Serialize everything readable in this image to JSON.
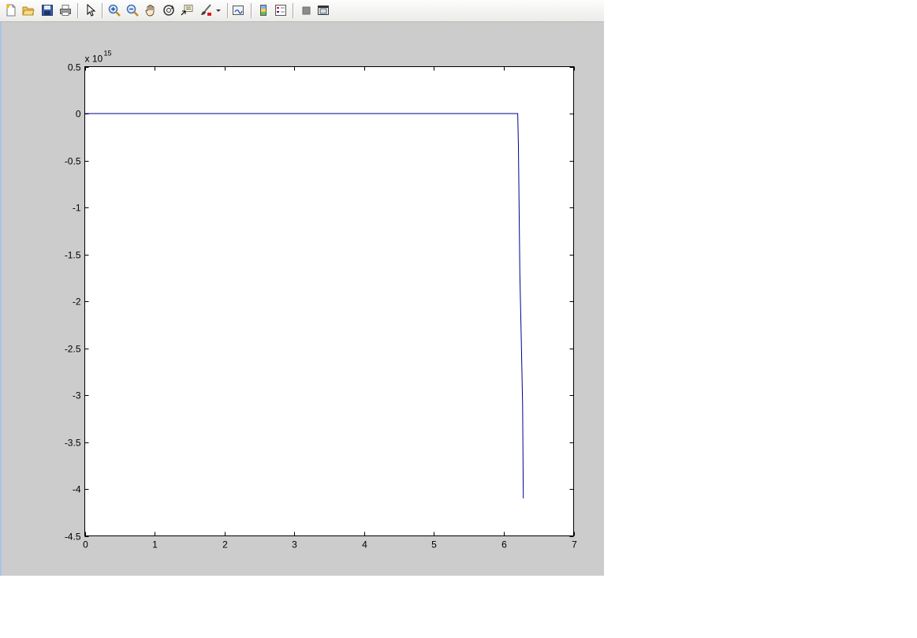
{
  "toolbar": {
    "buttons": [
      {
        "name": "new-figure-button",
        "icon": "new-document-icon"
      },
      {
        "name": "open-file-button",
        "icon": "folder-open-icon"
      },
      {
        "name": "save-figure-button",
        "icon": "save-disk-icon"
      },
      {
        "name": "print-figure-button",
        "icon": "printer-icon"
      },
      {
        "name": "edit-plot-button",
        "icon": "arrow-cursor-icon"
      },
      {
        "name": "zoom-in-button",
        "icon": "zoom-in-icon"
      },
      {
        "name": "zoom-out-button",
        "icon": "zoom-out-icon"
      },
      {
        "name": "pan-button",
        "icon": "hand-pan-icon"
      },
      {
        "name": "rotate-3d-button",
        "icon": "rotate-3d-icon"
      },
      {
        "name": "data-cursor-button",
        "icon": "data-cursor-icon"
      },
      {
        "name": "brush-button",
        "icon": "brush-icon"
      },
      {
        "name": "link-plot-button",
        "icon": "link-plot-icon"
      },
      {
        "name": "insert-colorbar-button",
        "icon": "colorbar-icon"
      },
      {
        "name": "insert-legend-button",
        "icon": "legend-icon"
      },
      {
        "name": "hide-plot-tools-button",
        "icon": "hide-tools-icon"
      },
      {
        "name": "show-plot-tools-button",
        "icon": "show-tools-icon"
      }
    ]
  },
  "colors": {
    "figure_background": "#cccccc",
    "axes_background": "#ffffff",
    "line": "#00008b"
  },
  "chart_data": {
    "type": "line",
    "title": "",
    "xlabel": "",
    "ylabel": "",
    "y_exponent_label": {
      "base": "x 10",
      "exponent": "15"
    },
    "xlim": [
      0,
      7
    ],
    "ylim": [
      -4.5,
      0.5
    ],
    "x_ticks": [
      0,
      1,
      2,
      3,
      4,
      5,
      6,
      7
    ],
    "x_tick_labels": [
      "0",
      "1",
      "2",
      "3",
      "4",
      "5",
      "6",
      "7"
    ],
    "y_ticks": [
      0.5,
      0,
      -0.5,
      -1,
      -1.5,
      -2,
      -2.5,
      -3,
      -3.5,
      -4,
      -4.5
    ],
    "y_tick_labels": [
      "0.5",
      "0",
      "-0.5",
      "-1",
      "-1.5",
      "-2",
      "-2.5",
      "-3",
      "-3.5",
      "-4",
      "-4.5"
    ],
    "grid": false,
    "series": [
      {
        "x": [
          0,
          1,
          2,
          3,
          4,
          5,
          6,
          6.2,
          6.21,
          6.23,
          6.25,
          6.27,
          6.28
        ],
        "y": [
          0,
          0,
          0,
          0,
          0,
          0,
          0,
          0,
          -0.35,
          -1.7,
          -2.4,
          -3.1,
          -4.1
        ]
      }
    ]
  }
}
